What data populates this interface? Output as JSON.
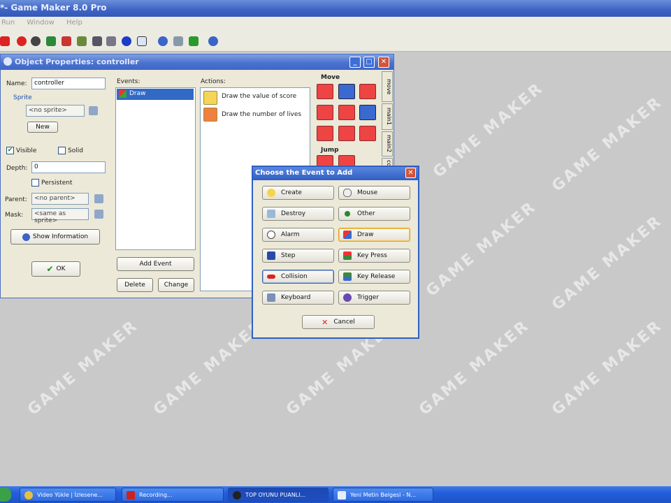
{
  "app": {
    "title": "*- Game Maker 8.0 Pro",
    "menu": [
      "Run",
      "Window",
      "Help"
    ]
  },
  "watermark": "GAME MAKER",
  "object_window": {
    "title": "Object Properties: controller",
    "name_label": "Name:",
    "name_value": "controller",
    "sprite_group": "Sprite",
    "sprite_value": "<no sprite>",
    "new_button": "New",
    "visible_label": "Visible",
    "solid_label": "Solid",
    "depth_label": "Depth:",
    "depth_value": "0",
    "persistent_label": "Persistent",
    "parent_label": "Parent:",
    "parent_value": "<no parent>",
    "mask_label": "Mask:",
    "mask_value": "<same as sprite>",
    "show_info_button": "Show Information",
    "ok_button": "OK",
    "events_label": "Events:",
    "events": [
      "Draw"
    ],
    "add_event_button": "Add Event",
    "delete_button": "Delete",
    "change_button": "Change",
    "actions_label": "Actions:",
    "actions": [
      "Draw the value of score",
      "Draw the number of lives"
    ],
    "move_header": "Move",
    "jump_header": "Jump",
    "tabs": [
      "move",
      "main1",
      "main2",
      "co"
    ]
  },
  "event_dialog": {
    "title": "Choose the Event to Add",
    "buttons": [
      {
        "label": "Create"
      },
      {
        "label": "Mouse"
      },
      {
        "label": "Destroy"
      },
      {
        "label": "Other"
      },
      {
        "label": "Alarm"
      },
      {
        "label": "Draw"
      },
      {
        "label": "Step"
      },
      {
        "label": "Key Press"
      },
      {
        "label": "Collision"
      },
      {
        "label": "Key Release"
      },
      {
        "label": "Keyboard"
      },
      {
        "label": "Trigger"
      }
    ],
    "cancel_button": "Cancel"
  },
  "taskbar": {
    "items": [
      "Video Yükle | İzlesene...",
      "Recording...",
      "TOP OYUNU PUANLI...",
      "Yeni Metin Belgesi - N..."
    ]
  },
  "colors": {
    "title_blue": "#3d63c4",
    "taskbar_blue": "#245edb",
    "selection": "#316ac5"
  }
}
